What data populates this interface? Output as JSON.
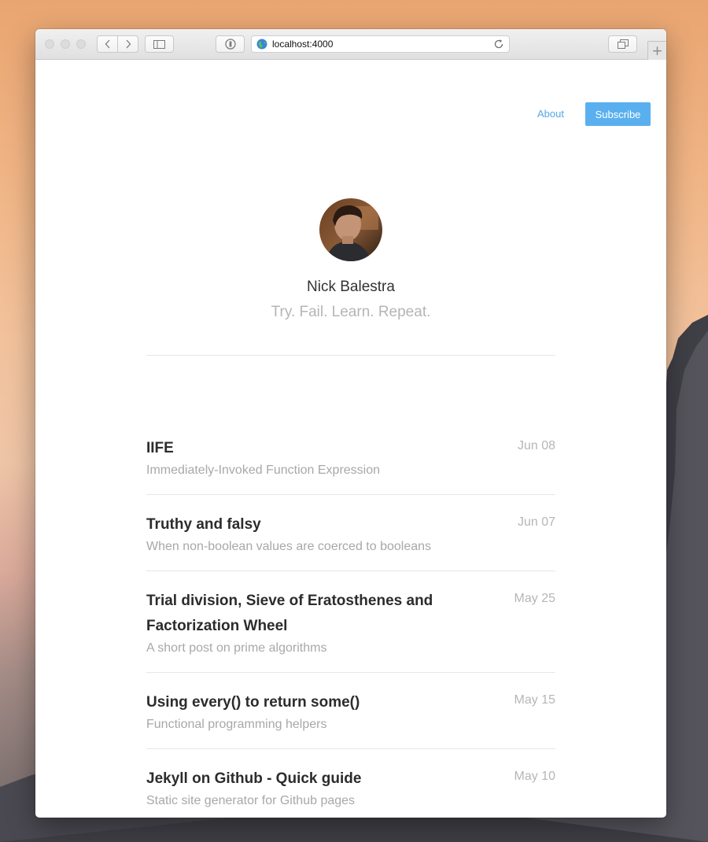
{
  "browser": {
    "url": "localhost:4000"
  },
  "nav": {
    "about": "About",
    "subscribe": "Subscribe"
  },
  "profile": {
    "name": "Nick Balestra",
    "tagline": "Try. Fail. Learn. Repeat."
  },
  "posts": [
    {
      "title": "IIFE",
      "date": "Jun 08",
      "description": "Immediately-Invoked Function Expression"
    },
    {
      "title": "Truthy and falsy",
      "date": "Jun 07",
      "description": "When non-boolean values are coerced to booleans"
    },
    {
      "title": "Trial division, Sieve of Eratosthenes and Factorization Wheel",
      "date": "May 25",
      "description": "A short post on prime algorithms"
    },
    {
      "title": "Using every() to return some()",
      "date": "May 15",
      "description": "Functional programming helpers"
    },
    {
      "title": "Jekyll on Github - Quick guide",
      "date": "May 10",
      "description": "Static site generator for Github pages"
    }
  ],
  "colors": {
    "accent": "#5ab0ef",
    "link": "#52a8e8"
  }
}
